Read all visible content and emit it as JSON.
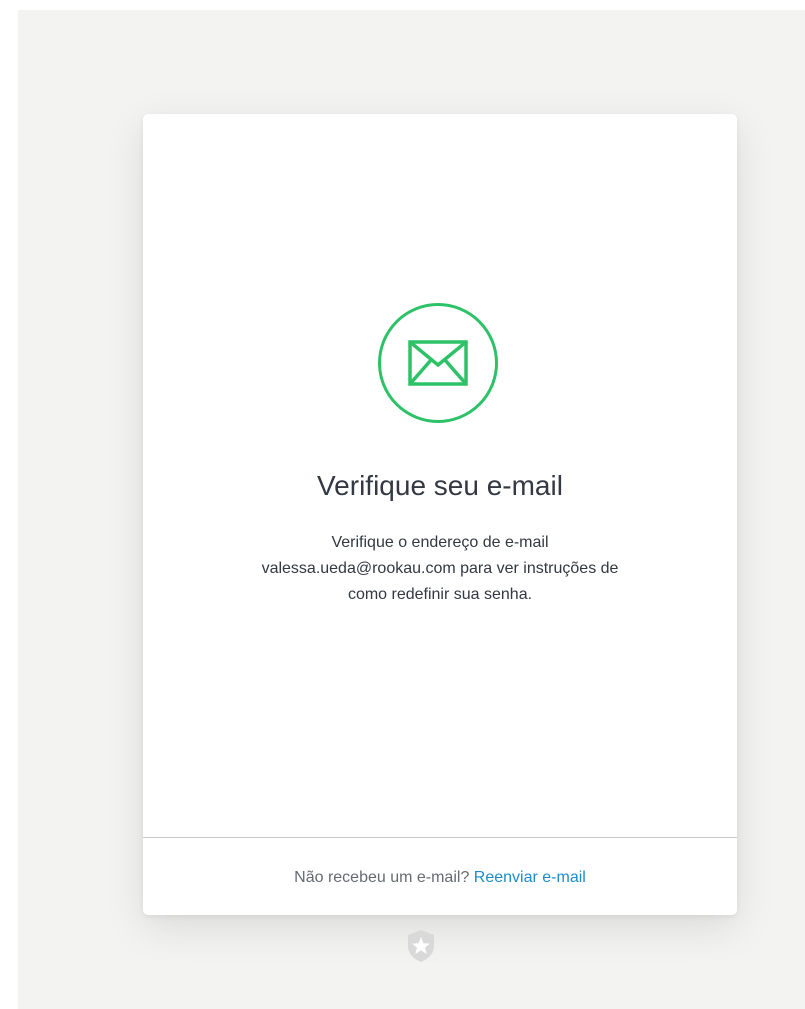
{
  "verify": {
    "title": "Verifique seu e-mail",
    "message_line1": "Verifique o endereço de e-mail",
    "message_line2": "valessa.ueda@rookau.com para ver instruções de",
    "message_line3": "como redefinir sua senha."
  },
  "footer": {
    "question": "Não recebeu um e-mail?",
    "resend_label": "Reenviar e-mail"
  },
  "icons": {
    "envelope": "envelope-icon",
    "logo": "star-shield-logo-icon"
  },
  "colors": {
    "accent_green": "#2dc268",
    "link_blue": "#1f8cc8",
    "text_dark": "#333842",
    "background": "#f3f3f2"
  }
}
